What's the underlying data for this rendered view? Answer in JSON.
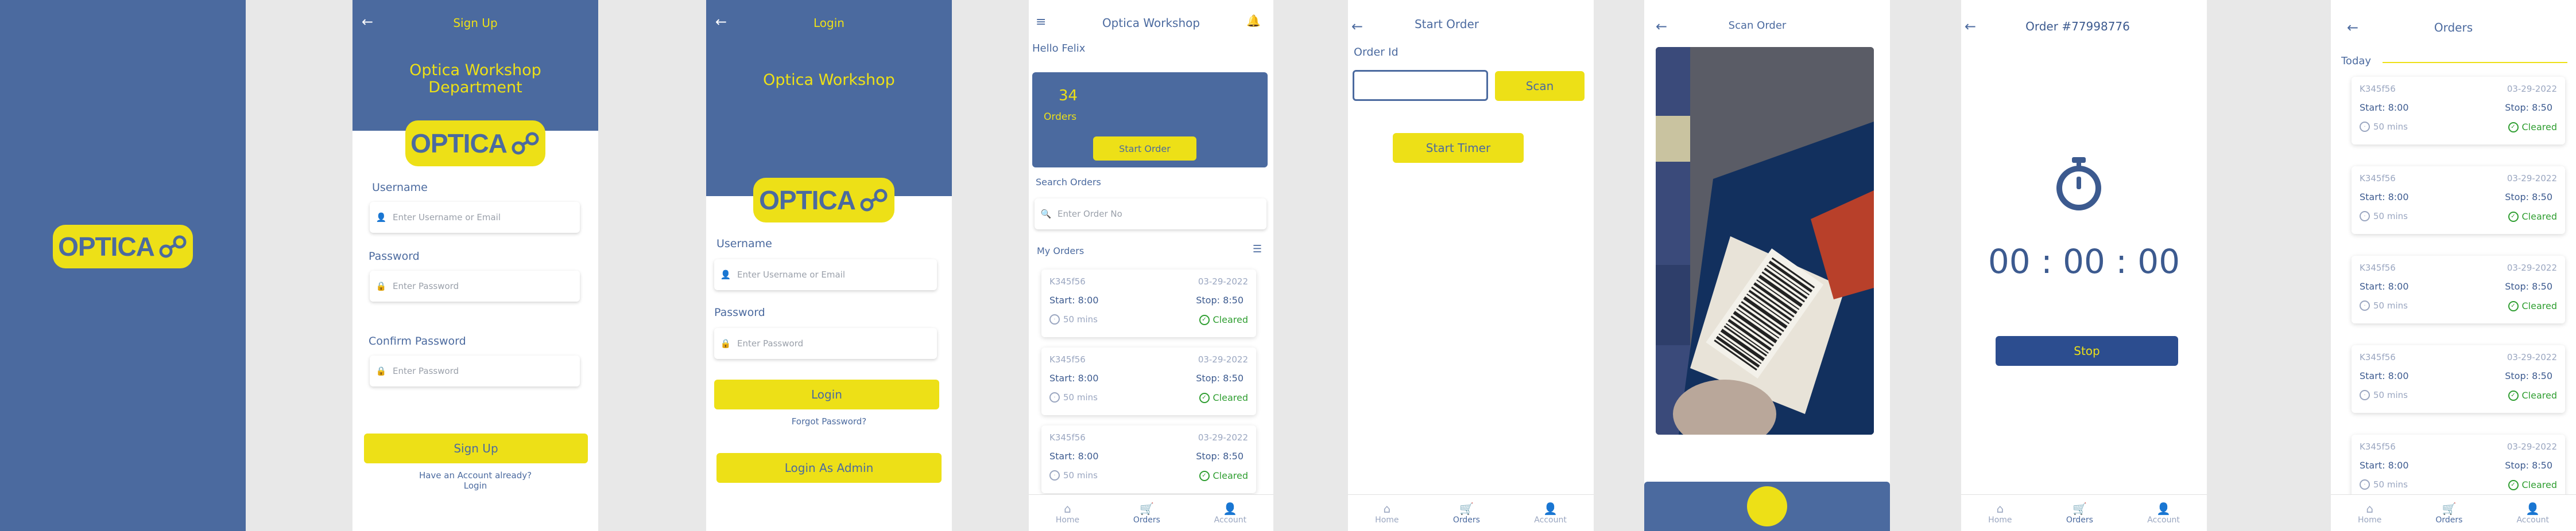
{
  "splash": {
    "logo": "OPTICA"
  },
  "signup": {
    "title": "Sign Up",
    "heading": "Optica Workshop\nDepartment",
    "logo": "OPTICA",
    "username_label": "Username",
    "username_placeholder": "Enter Username or Email",
    "password_label": "Password",
    "password_placeholder": "Enter Password",
    "confirm_label": "Confirm Password",
    "confirm_placeholder": "Enter Password",
    "signup_button": "Sign Up",
    "have_account": "Have an Account already?",
    "login_link": "Login"
  },
  "login": {
    "title": "Login",
    "heading": "Optica Workshop",
    "logo": "OPTICA",
    "username_label": "Username",
    "username_placeholder": "Enter Username or Email",
    "password_label": "Password",
    "password_placeholder": "Enter Password",
    "login_button": "Login",
    "forgot": "Forgot Password?",
    "admin_button": "Login As Admin"
  },
  "home": {
    "title": "Optica Workshop",
    "greeting": "Hello Felix",
    "count": "34",
    "count_label": "Orders",
    "start_order": "Start Order",
    "search_label": "Search Orders",
    "search_placeholder": "Enter Order No",
    "my_orders": "My Orders",
    "orders": [
      {
        "id": "K345f56",
        "date": "03-29-2022",
        "start": "Start: 8:00",
        "stop": "Stop: 8:50",
        "mins": "50 mins",
        "status": "Cleared"
      },
      {
        "id": "K345f56",
        "date": "03-29-2022",
        "start": "Start: 8:00",
        "stop": "Stop: 8:50",
        "mins": "50 mins",
        "status": "Cleared"
      },
      {
        "id": "K345f56",
        "date": "03-29-2022",
        "start": "Start: 8:00",
        "stop": "Stop: 8:50",
        "mins": "50 mins",
        "status": "Cleared"
      }
    ]
  },
  "start_order": {
    "title": "Start Order",
    "order_id_label": "Order Id",
    "scan_button": "Scan",
    "start_timer": "Start Timer"
  },
  "scan": {
    "title": "Scan Order"
  },
  "timer": {
    "title": "Order #77998776",
    "time": "00 : 00 : 00",
    "stop_button": "Stop"
  },
  "orders": {
    "title": "Orders",
    "section": "Today",
    "items": [
      {
        "id": "K345f56",
        "date": "03-29-2022",
        "start": "Start: 8:00",
        "stop": "Stop: 8:50",
        "mins": "50 mins",
        "status": "Cleared"
      },
      {
        "id": "K345f56",
        "date": "03-29-2022",
        "start": "Start: 8:00",
        "stop": "Stop: 8:50",
        "mins": "50 mins",
        "status": "Cleared"
      },
      {
        "id": "K345f56",
        "date": "03-29-2022",
        "start": "Start: 8:00",
        "stop": "Stop: 8:50",
        "mins": "50 mins",
        "status": "Cleared"
      },
      {
        "id": "K345f56",
        "date": "03-29-2022",
        "start": "Start: 8:00",
        "stop": "Stop: 8:50",
        "mins": "50 mins",
        "status": "Cleared"
      },
      {
        "id": "K345f56",
        "date": "03-29-2022",
        "start": "Start: 8:00",
        "stop": "Stop: 8:50",
        "mins": "50 mins",
        "status": "Cleared"
      }
    ]
  },
  "tabs": {
    "home": "Home",
    "orders": "Orders",
    "account": "Account"
  },
  "colors": {
    "brand_blue": "#4b6a9f",
    "brand_yellow": "#ede017",
    "cleared_green": "#2f9e31"
  },
  "icons": [
    "back-arrow-icon",
    "menu-icon",
    "bell-icon",
    "user-icon",
    "lock-icon",
    "search-icon",
    "filter-icon",
    "clock-icon",
    "check-circle-icon",
    "stopwatch-icon",
    "home-icon",
    "cart-icon",
    "account-icon"
  ]
}
